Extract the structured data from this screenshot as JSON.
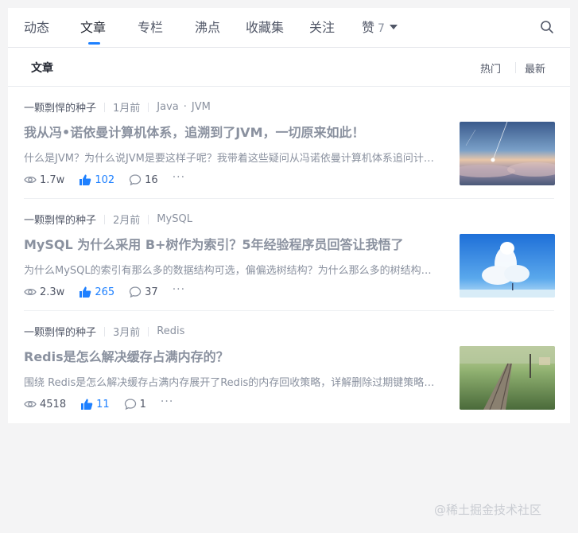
{
  "tabs": [
    {
      "label": "动态"
    },
    {
      "label": "文章"
    },
    {
      "label": "专栏"
    },
    {
      "label": "沸点"
    },
    {
      "label": "收藏集"
    },
    {
      "label": "关注"
    },
    {
      "label": "赞",
      "count": "7"
    }
  ],
  "subheader": {
    "title": "文章",
    "sort_hot": "热门",
    "sort_new": "最新"
  },
  "articles": [
    {
      "author": "一颗剽悍的种子",
      "time": "1月前",
      "tags": [
        "Java",
        "JVM"
      ],
      "title": "我从冯•诺依曼计算机体系，追溯到了JVM，一切原来如此！",
      "abstract": "什么是JVM？为什么说JVM是要这样子呢？我带着这些疑问从冯诺依曼计算机体系追问计算机的发展历程",
      "views": "1.7w",
      "likes": "102",
      "comments": "16",
      "thumb": "sky-star-sunset"
    },
    {
      "author": "一颗剽悍的种子",
      "time": "2月前",
      "tags": [
        "MySQL"
      ],
      "title": "MySQL 为什么采用 B+树作为索引？5年经验程序员回答让我悟了",
      "abstract": "为什么MySQL的索引有那么多的数据结构可选，偏偏选树结构？为什么那么多的树结构？为什么选择B+树",
      "views": "2.3w",
      "likes": "265",
      "comments": "37",
      "thumb": "blue-sky-clouds"
    },
    {
      "author": "一颗剽悍的种子",
      "time": "3月前",
      "tags": [
        "Redis"
      ],
      "title": "Redis是怎么解决缓存占满内存的？",
      "abstract": "围绕 Redis是怎么解决缓存占满内存展开了Redis的内存回收策略，详解删除过期键策略和内存淘汰策略",
      "views": "4518",
      "likes": "11",
      "comments": "1",
      "thumb": "railway-field"
    }
  ],
  "watermark": "@稀土掘金技术社区",
  "colors": {
    "accent": "#1e80ff",
    "text": "#515767",
    "muted": "#8a919f"
  }
}
